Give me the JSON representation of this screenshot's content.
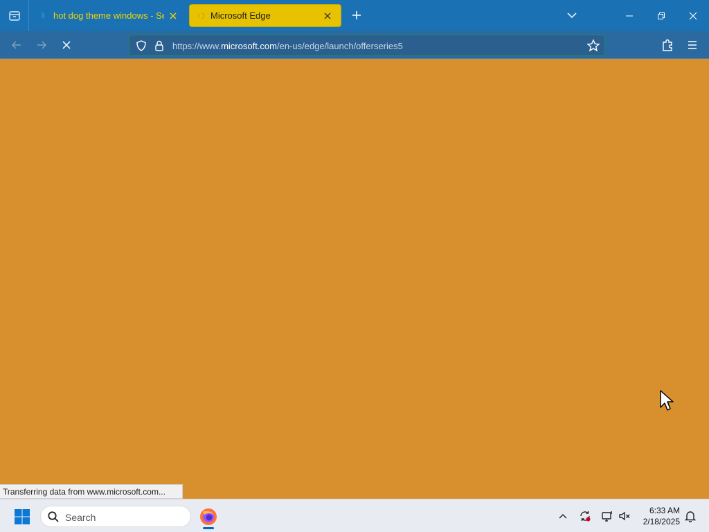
{
  "browser": {
    "tabs": [
      {
        "title": "hot dog theme windows - Search",
        "active": false
      },
      {
        "title": "Microsoft Edge",
        "active": true
      }
    ],
    "address_bar": {
      "url_prefix": "https://www.",
      "url_domain": "microsoft.com",
      "url_path": "/en-us/edge/launch/offerseries5"
    },
    "status_text": "Transferring data from www.microsoft.com..."
  },
  "taskbar": {
    "search_placeholder": "Search",
    "time": "6:33 AM",
    "date": "2/18/2025"
  },
  "colors": {
    "tabstrip": "#1a72b5",
    "active_tab": "#e6c200",
    "inactive_tab_text": "#f1d500",
    "content_background": "#d8902f"
  }
}
